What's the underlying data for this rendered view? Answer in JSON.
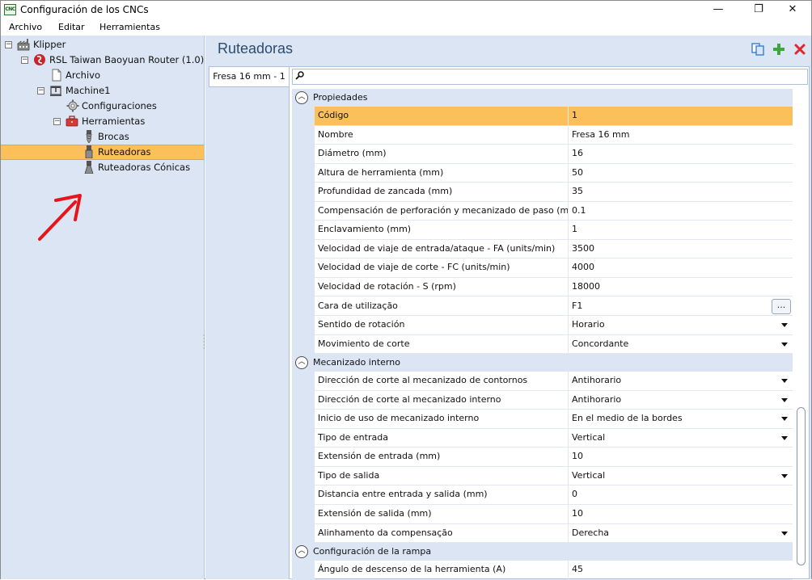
{
  "window": {
    "app_icon_text": "CNC",
    "title": "Configuración de los CNCs",
    "controls": {
      "minimize": "—",
      "maximize": "❐",
      "close": "✕"
    }
  },
  "menu": [
    "Archivo",
    "Editar",
    "Herramientas"
  ],
  "tree": {
    "nodes": [
      {
        "label": "Klipper",
        "icon": "factory-icon",
        "toggle": "−"
      },
      {
        "label": "RSL Taiwan Baoyuan Router (1.0)",
        "icon": "router-brand-icon",
        "toggle": "−"
      },
      {
        "label": "Archivo",
        "icon": "document-icon"
      },
      {
        "label": "Machine1",
        "icon": "machine-icon",
        "toggle": "−"
      },
      {
        "label": "Configuraciones",
        "icon": "gear-icon"
      },
      {
        "label": "Herramientas",
        "icon": "toolbox-icon",
        "toggle": "−"
      },
      {
        "label": "Brocas",
        "icon": "drill-bit-icon"
      },
      {
        "label": "Ruteadoras",
        "icon": "router-bit-icon",
        "selected": true
      },
      {
        "label": "Ruteadoras Cónicas",
        "icon": "conical-router-bit-icon"
      }
    ]
  },
  "panel": {
    "title": "Ruteadoras",
    "tools": [
      "copy-icon",
      "add-icon",
      "delete-icon"
    ],
    "tab_label": "Fresa 16 mm - 1",
    "search_placeholder": ""
  },
  "property_grid": {
    "categories": [
      {
        "label": "Propiedades",
        "rows": [
          {
            "name": "Código",
            "value": "1",
            "selected": true
          },
          {
            "name": "Nombre",
            "value": "Fresa 16 mm"
          },
          {
            "name": "Diámetro (mm)",
            "value": "16"
          },
          {
            "name": "Altura de herramienta (mm)",
            "value": "50"
          },
          {
            "name": "Profundidad de zancada (mm)",
            "value": "35"
          },
          {
            "name": "Compensación de perforación y mecanizado de paso (mm)",
            "value": "0.1"
          },
          {
            "name": "Enclavamiento (mm)",
            "value": "1"
          },
          {
            "name": "Velocidad de viaje de entrada/ataque - FA (units/min)",
            "value": "3500"
          },
          {
            "name": "Velocidad de viaje de corte - FC (units/min)",
            "value": "4000"
          },
          {
            "name": "Velocidad de rotación - S (rpm)",
            "value": "18000"
          },
          {
            "name": "Cara de utilização",
            "value": "F1",
            "editor": "ellipsis",
            "button_label": "..."
          },
          {
            "name": "Sentido de rotación",
            "value": "Horario",
            "editor": "dropdown"
          },
          {
            "name": "Movimiento de corte",
            "value": "Concordante",
            "editor": "dropdown"
          }
        ]
      },
      {
        "label": "Mecanizado interno",
        "rows": [
          {
            "name": "Dirección de corte al mecanizado de contornos",
            "value": "Antihorario",
            "editor": "dropdown"
          },
          {
            "name": "Dirección de corte al mecanizado interno",
            "value": "Antihorario",
            "editor": "dropdown"
          },
          {
            "name": "Inicio de uso de mecanizado interno",
            "value": "En el medio de la bordes",
            "editor": "dropdown"
          },
          {
            "name": "Tipo de entrada",
            "value": "Vertical",
            "editor": "dropdown"
          },
          {
            "name": "Extensión de entrada (mm)",
            "value": "10"
          },
          {
            "name": "Tipo de salida",
            "value": "Vertical",
            "editor": "dropdown"
          },
          {
            "name": "Distancia entre entrada y salida (mm)",
            "value": "0"
          },
          {
            "name": "Extensión de salida (mm)",
            "value": "10"
          },
          {
            "name": "Alinhamento da compensação",
            "value": "Derecha",
            "editor": "dropdown"
          }
        ]
      },
      {
        "label": "Configuración de la rampa",
        "rows": [
          {
            "name": "Ángulo de descenso de la herramienta (A)",
            "value": "45"
          }
        ]
      }
    ]
  },
  "colors": {
    "panel_bg": "#dbe5f3",
    "selection": "#fbc05a",
    "title_text": "#2c4c6e",
    "annotation_arrow": "#e8141c"
  }
}
